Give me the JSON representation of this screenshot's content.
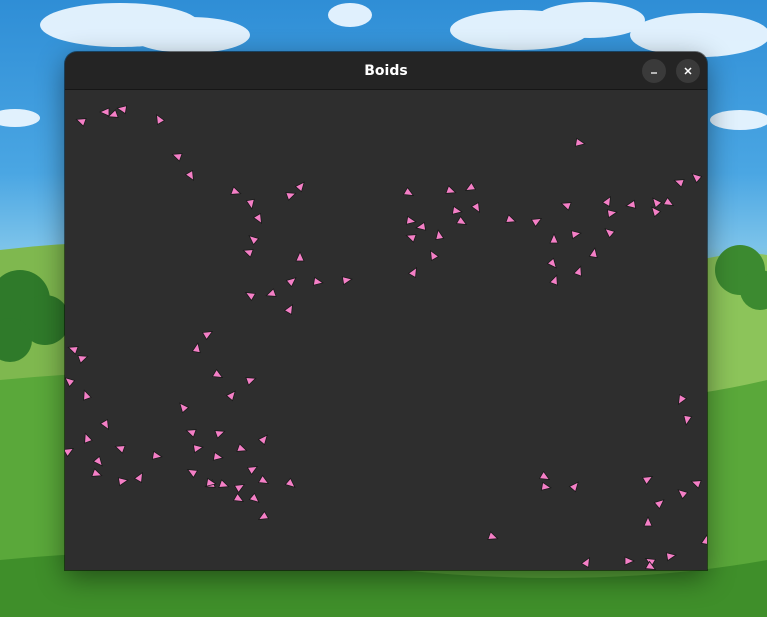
{
  "window": {
    "title": "Boids",
    "minimize_icon": "minimize-icon",
    "close_icon": "close-icon"
  },
  "colors": {
    "boid_fill": "#f47fc6",
    "boid_stroke": "#1a1a1a",
    "canvas_bg": "#2e2e2e",
    "titlebar_bg": "#242424"
  },
  "boid_count": 120
}
